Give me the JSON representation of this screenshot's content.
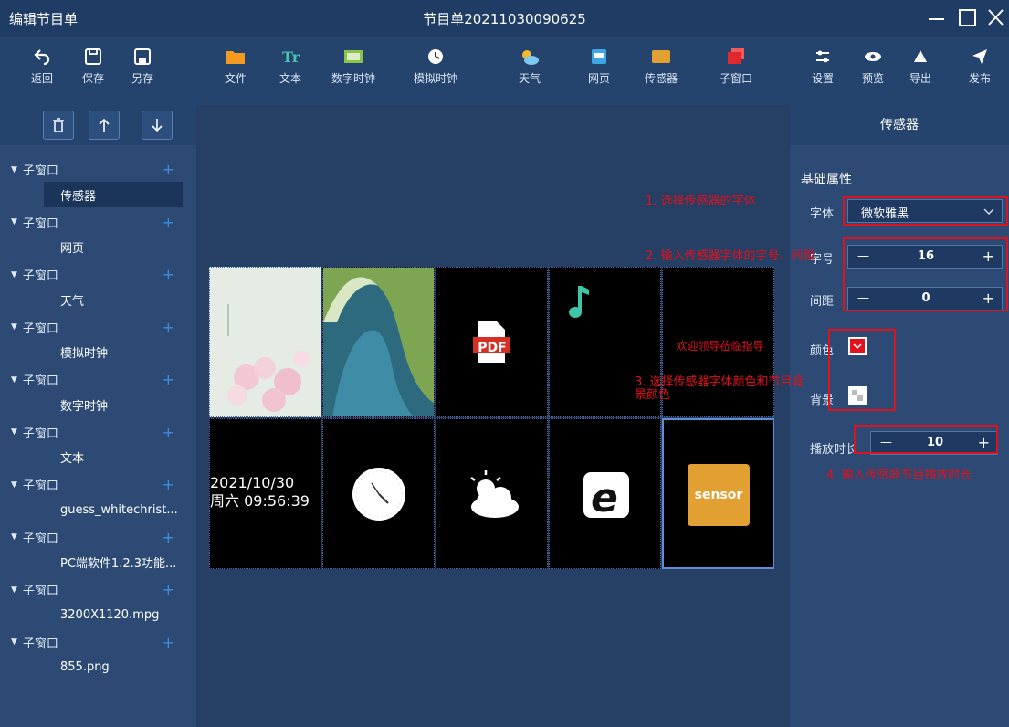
{
  "window": {
    "left_title": "编辑节目单",
    "center_title": "节目单20211030090625"
  },
  "toolbar": {
    "back": "返回",
    "save": "保存",
    "save_as": "另存",
    "file": "文件",
    "text": "文本",
    "digital_clock": "数字时钟",
    "analog_clock": "模拟时钟",
    "weather": "天气",
    "webpage": "网页",
    "sensor": "传感器",
    "subwindow": "子窗口",
    "settings": "设置",
    "preview": "预览",
    "export": "导出",
    "publish": "发布"
  },
  "tree": {
    "items": [
      {
        "group": "子窗口",
        "child": "传感器"
      },
      {
        "group": "子窗口",
        "child": "网页"
      },
      {
        "group": "子窗口",
        "child": "天气"
      },
      {
        "group": "子窗口",
        "child": "模拟时钟"
      },
      {
        "group": "子窗口",
        "child": "数字时钟"
      },
      {
        "group": "子窗口",
        "child": "文本"
      },
      {
        "group": "子窗口",
        "child": "guess_whitechrist..."
      },
      {
        "group": "子窗口",
        "child": "PC端软件1.2.3功能..."
      },
      {
        "group": "子窗口",
        "child": "3200X1120.mpg"
      },
      {
        "group": "子窗口",
        "child": "855.png"
      }
    ]
  },
  "canvas": {
    "welcome_text": "欢迎领导莅临指导",
    "digital_clock_date": "2021/10/30",
    "digital_clock_time": "周六 09:56:39",
    "pdf_label": "PDF",
    "sensor_label": "sensor"
  },
  "panel": {
    "title": "传感器",
    "section": "基础属性",
    "font_label": "字体",
    "font_value": "微软雅黑",
    "size_label": "字号",
    "size_value": "16",
    "spacing_label": "间距",
    "spacing_value": "0",
    "color_label": "颜色",
    "bg_label": "背景",
    "duration_label": "播放时长",
    "duration_value": "10",
    "minus": "—",
    "plus": "+"
  },
  "annotations": {
    "a1": "1. 选择传感器的字体",
    "a2": "2. 输入传感器字体的字号、间距",
    "a3": "3. 选择传感器字体颜色和节目背景颜色",
    "a4": "4. 输入传感器节目播放时长"
  },
  "colors": {
    "accent": "#3f8be3",
    "annotation": "#e0121d",
    "sensor_tile": "#e2a032"
  }
}
